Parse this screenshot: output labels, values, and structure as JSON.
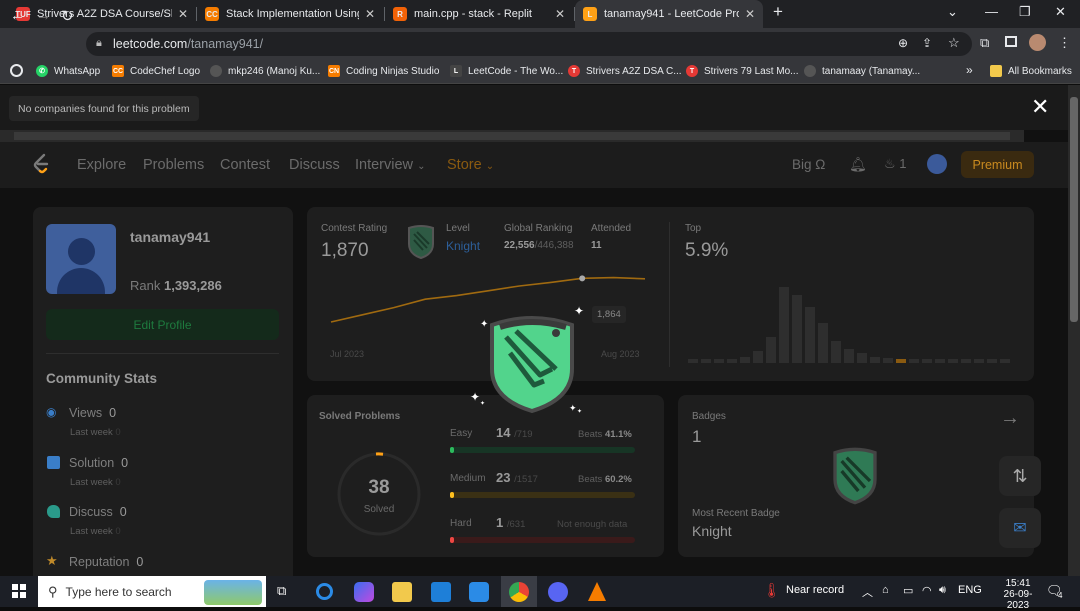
{
  "browser": {
    "tabs": [
      {
        "title": "Strivers A2Z DSA Course/Sheet -",
        "favicon": "TUF",
        "favicon_color": "#e53935"
      },
      {
        "title": "Stack Implementation Using Arra",
        "favicon": "CC",
        "favicon_color": "#f57c00"
      },
      {
        "title": "main.cpp - stack - Replit",
        "favicon": "R",
        "favicon_color": "#f26207"
      },
      {
        "title": "tanamay941 - LeetCode Profile",
        "favicon": "L",
        "favicon_color": "#ffa116"
      }
    ],
    "active_tab_index": 3,
    "url_domain": "leetcode.com",
    "url_path": "/tanamay941/",
    "bookmarks": [
      {
        "label": "WhatsApp"
      },
      {
        "label": "CodeChef Logo"
      },
      {
        "label": "mkp246 (Manoj Ku..."
      },
      {
        "label": "Coding Ninjas Studio"
      },
      {
        "label": "LeetCode - The Wo..."
      },
      {
        "label": "Strivers A2Z DSA C..."
      },
      {
        "label": "Strivers 79 Last Mo..."
      },
      {
        "label": "tanamaay (Tanamay..."
      }
    ],
    "bookmarks_overflow": "»",
    "all_bookmarks": "All Bookmarks"
  },
  "page": {
    "toast": "No companies found for this problem",
    "nav": {
      "items": [
        "Explore",
        "Problems",
        "Contest",
        "Discuss",
        "Interview",
        "Store"
      ],
      "big_omega": "Big Ω",
      "streak": "1",
      "premium": "Premium"
    },
    "profile": {
      "username": "tanamay941",
      "rank_label": "Rank",
      "rank": "1,393,286",
      "edit_button": "Edit Profile",
      "community_title": "Community Stats",
      "stats": [
        {
          "label": "Views",
          "value": "0",
          "sub": "Last week",
          "subval": "0"
        },
        {
          "label": "Solution",
          "value": "0",
          "sub": "Last week",
          "subval": "0"
        },
        {
          "label": "Discuss",
          "value": "0",
          "sub": "Last week",
          "subval": "0"
        },
        {
          "label": "Reputation",
          "value": "0"
        }
      ]
    },
    "contest": {
      "rating_label": "Contest Rating",
      "rating": "1,870",
      "level_label": "Level",
      "level": "Knight",
      "global_label": "Global Ranking",
      "global_rank": "22,556",
      "global_total": "/446,388",
      "attended_label": "Attended",
      "attended": "11",
      "tooltip": "1,864",
      "x_start": "Jul 2023",
      "x_end": "Aug 2023",
      "top_label": "Top",
      "top_value": "5.9%"
    },
    "solved": {
      "title": "Solved Problems",
      "total": "38",
      "total_label": "Solved",
      "rows": [
        {
          "level": "Easy",
          "count": "14",
          "total": "/719",
          "beats_label": "Beats",
          "beats": "41.1%",
          "color": "#2cbb5d",
          "fraction": 0.02
        },
        {
          "level": "Medium",
          "count": "23",
          "total": "/1517",
          "beats_label": "Beats",
          "beats": "60.2%",
          "color": "#ffc01e",
          "fraction": 0.015
        },
        {
          "level": "Hard",
          "count": "1",
          "total": "/631",
          "note": "Not enough data",
          "color": "#ef4743",
          "fraction": 0.002
        }
      ]
    },
    "badges": {
      "title": "Badges",
      "count": "1",
      "recent_label": "Most Recent Badge",
      "recent": "Knight"
    }
  },
  "taskbar": {
    "search_placeholder": "Type here to search",
    "weather": "Near record",
    "lang": "ENG",
    "time": "15:41",
    "date": "26-09-2023",
    "notif_count": "4"
  },
  "colors": {
    "accent": "#ffa116",
    "green": "#2cbb5d",
    "badge_green": "#52d48c"
  },
  "chart_data": {
    "type": "line",
    "x": [
      "Jul 2023",
      "Aug 2023"
    ],
    "series": [
      {
        "values": [
          1500,
          1560,
          1620,
          1690,
          1720,
          1760,
          1800,
          1830,
          1864,
          1870,
          1860
        ]
      }
    ],
    "ylim": [
      1400,
      1900
    ]
  }
}
